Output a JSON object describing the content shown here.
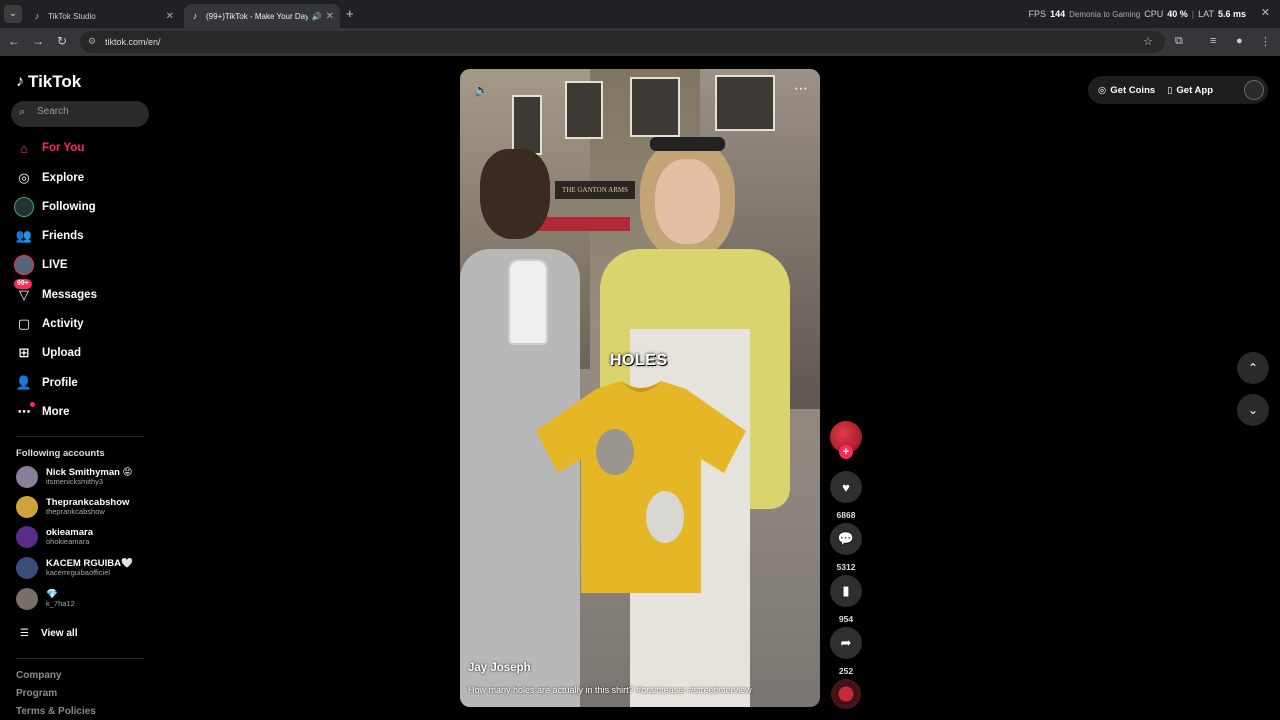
{
  "browser": {
    "tabs": [
      {
        "title": "TikTok Studio",
        "close": "✕"
      },
      {
        "title": "(99+)TikTok - Make Your Day",
        "close": "✕"
      }
    ],
    "new_tab": "+",
    "url": "tiktok.com/en/",
    "perf": {
      "fps_label": "FPS",
      "fps": "144",
      "cpu_label": "CPU",
      "cpu": "40 %",
      "lat_label": "LAT",
      "lat": "5.6 ms",
      "title_overlay": "Demonia to Gaming"
    }
  },
  "sidebar": {
    "logo": "TikTok",
    "search_placeholder": "Search",
    "nav": [
      {
        "label": "For You",
        "icon": "home-icon"
      },
      {
        "label": "Explore",
        "icon": "compass-icon"
      },
      {
        "label": "Following",
        "icon": "following-avatar-icon"
      },
      {
        "label": "Friends",
        "icon": "friends-icon"
      },
      {
        "label": "LIVE",
        "icon": "live-icon"
      },
      {
        "label": "Messages",
        "icon": "messages-icon",
        "badge": "99+"
      },
      {
        "label": "Activity",
        "icon": "activity-icon"
      },
      {
        "label": "Upload",
        "icon": "upload-icon"
      },
      {
        "label": "Profile",
        "icon": "profile-icon"
      },
      {
        "label": "More",
        "icon": "more-icon"
      }
    ],
    "following_title": "Following accounts",
    "accounts": [
      {
        "name": "Nick Smithyman 😝",
        "handle": "itsmenicksmithy3",
        "color": "#8a7f9a"
      },
      {
        "name": "Theprankcabshow",
        "handle": "theprankcabshow",
        "color": "#d0a23a"
      },
      {
        "name": "okieamara",
        "handle": "ohokieamara",
        "color": "#5b2b8a"
      },
      {
        "name": "KACEM RGUIBA🤍",
        "handle": "kacemrguibaofficiel",
        "color": "#3c4d7a"
      },
      {
        "name": "💎",
        "handle": "k_7ha12",
        "color": "#777066"
      }
    ],
    "view_all": "View all",
    "footer": [
      "Company",
      "Program",
      "Terms & Policies"
    ]
  },
  "video": {
    "overlay_text": "HOLES",
    "author": "Jay Joseph",
    "caption": "How many holes are actually in this shirt? #brainteaser #streetinterview",
    "shop_sign": "THE GANTON ARMS"
  },
  "actions": {
    "likes": "6868",
    "comments": "5312",
    "saves": "954",
    "shares": "252"
  },
  "topbar": {
    "get_coins": "Get Coins",
    "get_app": "Get App"
  },
  "colors": {
    "accent": "#fe2c55",
    "shirt": "#e5b626",
    "bg": "#000000"
  }
}
